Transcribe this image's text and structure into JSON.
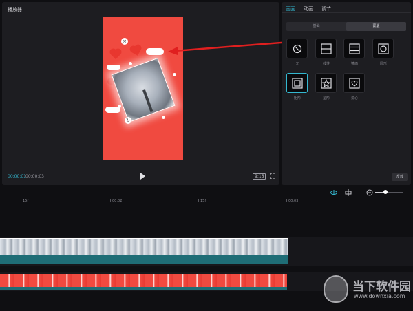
{
  "player": {
    "title": "播放器",
    "time_current": "00:00:01",
    "time_total": "00:00:03",
    "ratio_label": "9:16",
    "play_icon": "play-icon",
    "fullscreen_icon": "fullscreen-icon"
  },
  "props": {
    "tabs": [
      {
        "label": "画面",
        "active": true
      },
      {
        "label": "动画",
        "active": false
      },
      {
        "label": "调节",
        "active": false
      }
    ],
    "segments": [
      {
        "label": "基础",
        "active": false
      },
      {
        "label": "蒙版",
        "active": true
      }
    ],
    "masks": [
      {
        "label": "无",
        "icon": "none-icon"
      },
      {
        "label": "线性",
        "icon": "linear-icon"
      },
      {
        "label": "镜面",
        "icon": "mirror-icon"
      },
      {
        "label": "圆形",
        "icon": "circle-icon"
      },
      {
        "label": "矩形",
        "icon": "rectangle-icon",
        "selected": true
      },
      {
        "label": "星形",
        "icon": "star-icon"
      },
      {
        "label": "爱心",
        "icon": "heart-icon"
      }
    ],
    "reverse_label": "反转"
  },
  "timeline": {
    "ruler": [
      "15f",
      "00:02",
      "15f",
      "00:03"
    ]
  },
  "watermark": {
    "text": "当下软件园",
    "url": "www.downxia.com"
  },
  "colors": {
    "accent": "#34b8d0",
    "panel_bg": "#1d1d21",
    "preview_red": "#f04a40",
    "arrow_red": "#e01f1f",
    "clip_teal": "#1f6d76"
  }
}
